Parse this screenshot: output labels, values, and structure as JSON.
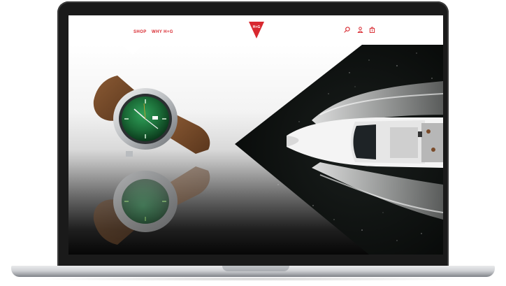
{
  "nav": {
    "shop_label": "SHOP",
    "why_label": "WHY H+G"
  },
  "brand": {
    "logo_text": "H+G",
    "accent_color": "#d8282f"
  },
  "icons": {
    "search": "search-icon",
    "account": "user-icon",
    "cart": "shopping-bag-icon"
  },
  "hero": {
    "left_image": "wristwatch-with-green-dial-and-brown-leather-strap",
    "right_image": "aerial-view-of-speedboat-on-dark-water"
  }
}
